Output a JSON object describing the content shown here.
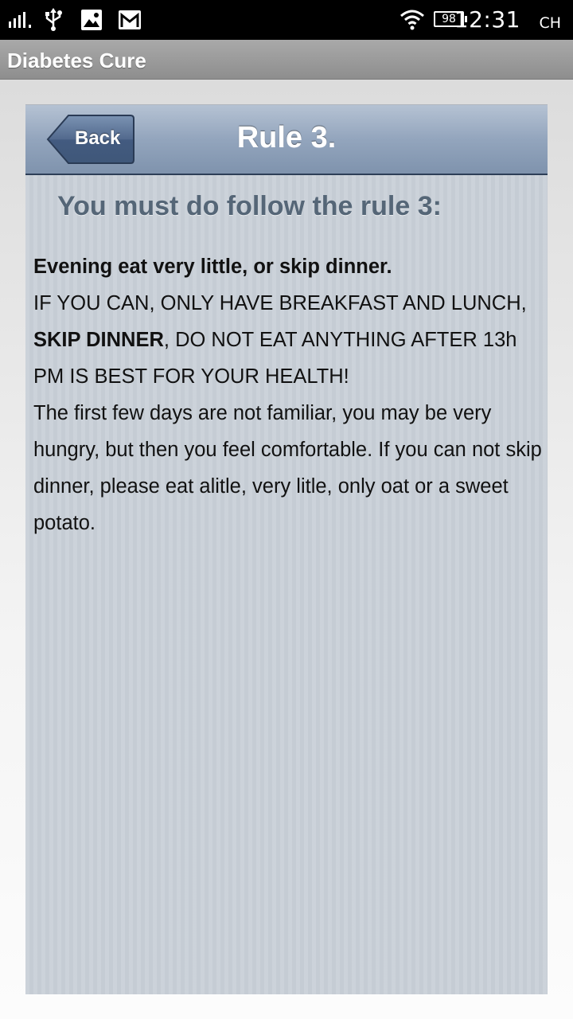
{
  "status_bar": {
    "time": "12:31",
    "input_method": "CH",
    "battery": "98",
    "icons": [
      "signal-icon",
      "usb-icon",
      "image-icon",
      "gmail-icon",
      "wifi-icon",
      "battery-icon"
    ]
  },
  "app_bar": {
    "title": "Diabetes Cure"
  },
  "nav": {
    "back_label": "Back",
    "title": "Rule 3."
  },
  "content": {
    "heading": "You must do follow the rule 3:",
    "lead": "Evening eat very little, or skip dinner.",
    "caps_part1": "IF YOU CAN, ONLY HAVE BREAKFAST AND LUNCH, ",
    "caps_bold": "SKIP DINNER",
    "caps_part2": ", DO NOT EAT ANYTHING AFTER 13h PM IS BEST FOR YOUR HEALTH!",
    "paragraph": "The first few days are not familiar, you may be very hungry, but then you feel comfortable. If you can not skip dinner, please eat alitle, very litle, only oat or a sweet potato."
  },
  "colors": {
    "nav_bar": "#8c9fb8",
    "back_button": "#4a6488",
    "panel_bg": "#c5ccd4",
    "heading_text": "#556677"
  }
}
